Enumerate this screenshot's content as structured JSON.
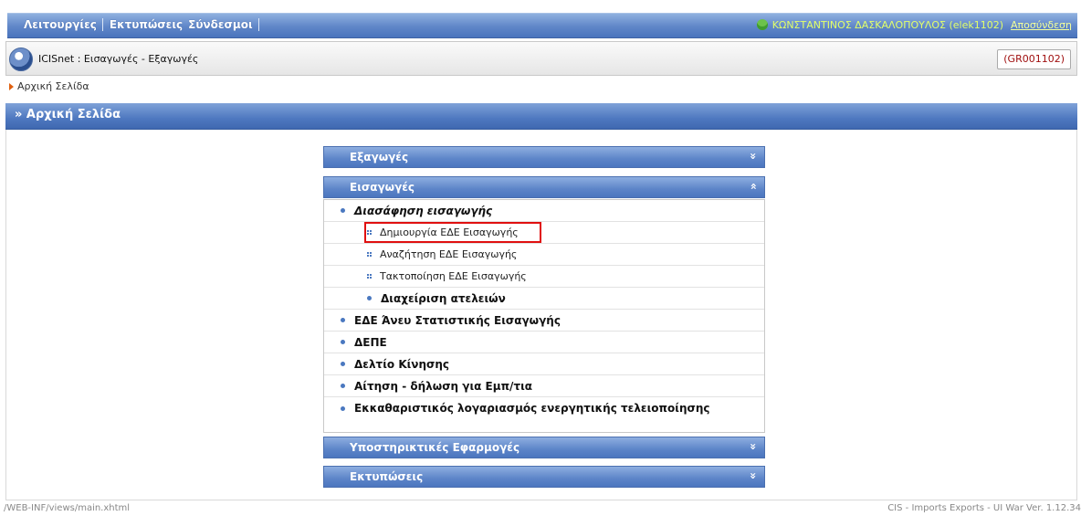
{
  "menu": {
    "items": [
      "Λειτουργίες",
      "Εκτυπώσεις",
      "Σύνδεσμοι"
    ]
  },
  "user": {
    "name": "ΚΩΝΣΤΑΝΤΙΝΟΣ ΔΑΣΚΑΛΟΠΟΥΛΟΣ (elek1102)",
    "logout": "Αποσύνδεση"
  },
  "app": {
    "title": "ICISnet : Εισαγωγές - Εξαγωγές",
    "code": "(GR001102)"
  },
  "breadcrumb": {
    "item": "Αρχική Σελίδα"
  },
  "page_header": {
    "title": "» Αρχική Σελίδα"
  },
  "accordion": {
    "exports": "Εξαγωγές",
    "imports": "Εισαγωγές",
    "support": "Υποστηρικτικές Εφαρμογές",
    "prints": "Εκτυπώσεις"
  },
  "imports_menu": {
    "clearance": "Διασάφηση εισαγωγής",
    "create": "Δημιουργία ΕΔΕ Εισαγωγής",
    "search": "Αναζήτηση ΕΔΕ Εισαγωγής",
    "settle": "Τακτοποίηση ΕΔΕ Εισαγωγής",
    "exemptions": "Διαχείριση ατελειών",
    "no_stat": "ΕΔΕ Άνευ Στατιστικής Εισαγωγής",
    "depe": "ΔΕΠΕ",
    "movement": "Δελτίο Κίνησης",
    "request": "Αίτηση - δήλωση για Εμπ/τια",
    "clearing": "Εκκαθαριστικός λογαριασμός ενεργητικής τελειοποίησης"
  },
  "footer": {
    "path": "/WEB-INF/views/main.xhtml",
    "version": "CIS - Imports Exports - UI War Ver. 1.12.34"
  },
  "colors": {
    "header_blue": "#5c84c8",
    "highlight": "#e01010",
    "code_red": "#a01010"
  }
}
